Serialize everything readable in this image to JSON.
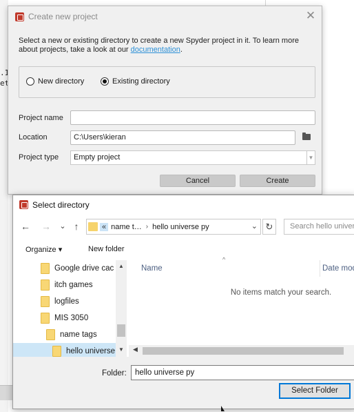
{
  "background": {
    "snippet_1": ".1",
    "snippet_2": "et"
  },
  "create_project": {
    "title": "Create new project",
    "close_glyph": "✕",
    "description_text": "Select a new or existing directory to create a new Spyder project in it. To learn more about projects, take a look at our ",
    "description_link": "documentation",
    "description_end": ".",
    "radio_new": "New directory",
    "radio_existing": "Existing directory",
    "selected_radio": "Existing directory",
    "project_name_label": "Project name",
    "project_name_value": "",
    "location_label": "Location",
    "location_value": "C:\\Users\\kieran",
    "project_type_label": "Project type",
    "project_type_value": "Empty project",
    "cancel_label": "Cancel",
    "create_label": "Create"
  },
  "select_directory": {
    "title": "Select directory",
    "nav": {
      "back_glyph": "←",
      "forward_glyph": "→",
      "recent_glyph": "⌄",
      "up_glyph": "↑",
      "refresh_glyph": "↻"
    },
    "address": {
      "overflow": "«",
      "crumbs": [
        "name t…",
        "hello universe py"
      ],
      "separator": "›",
      "drop_glyph": "⌄"
    },
    "search_placeholder": "Search hello universe py",
    "organize_label": "Organize ▾",
    "new_folder_label": "New folder",
    "tree": [
      {
        "label": "Google drive cac",
        "indent": 0,
        "selected": false
      },
      {
        "label": "itch games",
        "indent": 0,
        "selected": false
      },
      {
        "label": "logfiles",
        "indent": 0,
        "selected": false
      },
      {
        "label": "MIS 3050",
        "indent": 0,
        "selected": false
      },
      {
        "label": "name tags",
        "indent": 1,
        "selected": false
      },
      {
        "label": "hello universe",
        "indent": 2,
        "selected": true
      }
    ],
    "columns": {
      "name": "Name",
      "date": "Date mod"
    },
    "empty_message": "No items match your search.",
    "folder_label": "Folder:",
    "folder_value": "hello universe py",
    "select_button": "Select Folder"
  }
}
